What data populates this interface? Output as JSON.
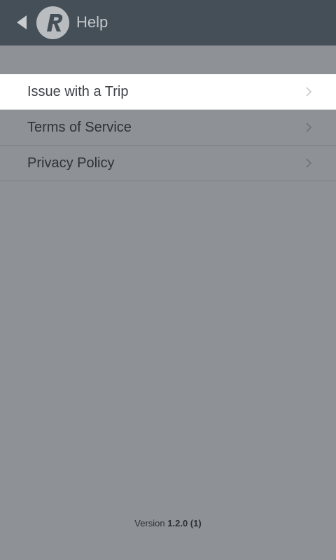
{
  "header": {
    "title": "Help",
    "back_icon": "back-arrow-icon",
    "logo_icon": "r-logo-icon"
  },
  "menu": {
    "items": [
      {
        "label": "Issue with a Trip",
        "selected": true
      },
      {
        "label": "Terms of Service",
        "selected": false
      },
      {
        "label": "Privacy Policy",
        "selected": false
      }
    ]
  },
  "footer": {
    "version_label": "Version",
    "version_number": "1.2.0 (1)"
  },
  "colors": {
    "header_bg": "#444f58",
    "page_bg": "#8e9195",
    "selected_row_bg": "#ffffff"
  }
}
